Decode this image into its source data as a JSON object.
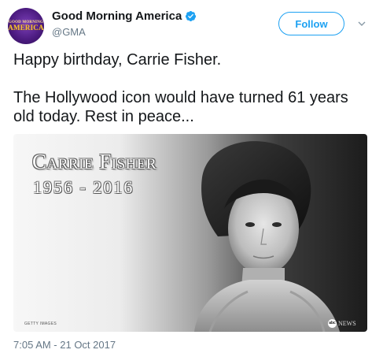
{
  "account": {
    "display_name": "Good Morning America",
    "handle": "@GMA",
    "verified": true,
    "avatar_logo_small": "GOOD MORNING",
    "avatar_logo_big": "AMERICA"
  },
  "actions": {
    "follow_label": "Follow",
    "more_icon": "chevron-down-icon"
  },
  "tweet": {
    "line1": "Happy birthday, Carrie Fisher.",
    "line2": "The Hollywood icon would have turned 61 years old today. Rest in peace..."
  },
  "media": {
    "title_name": "Carrie Fisher",
    "title_years": "1956 - 2016",
    "credit": "GETTY IMAGES",
    "network_logo": "abc",
    "network_text": "NEWS"
  },
  "meta": {
    "timestamp": "7:05 AM - 21 Oct 2017"
  },
  "colors": {
    "accent": "#1da1f2",
    "muted": "#657786",
    "text": "#14171a"
  }
}
